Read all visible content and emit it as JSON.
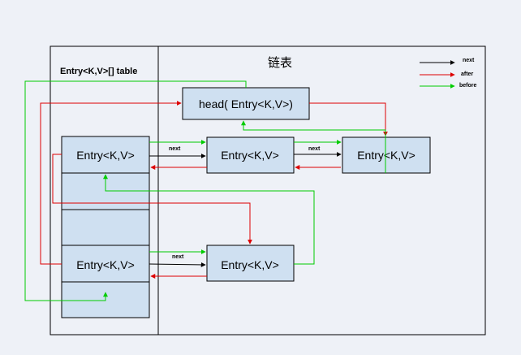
{
  "table_label": "Entry<K,V>[] table",
  "list_label": "链表",
  "legend": [
    {
      "label": "next",
      "color": "#000000"
    },
    {
      "label": "after",
      "color": "#dd0000"
    },
    {
      "label": "before",
      "color": "#00cc00"
    }
  ],
  "head_label": "head( Entry<K,V>)",
  "entry_label": "Entry<K,V>",
  "next_label": "next",
  "colors": {
    "background": "#eef1f7",
    "box_fill": "#cfe0f1",
    "next": "#000000",
    "after": "#dd0000",
    "before": "#00cc00"
  }
}
